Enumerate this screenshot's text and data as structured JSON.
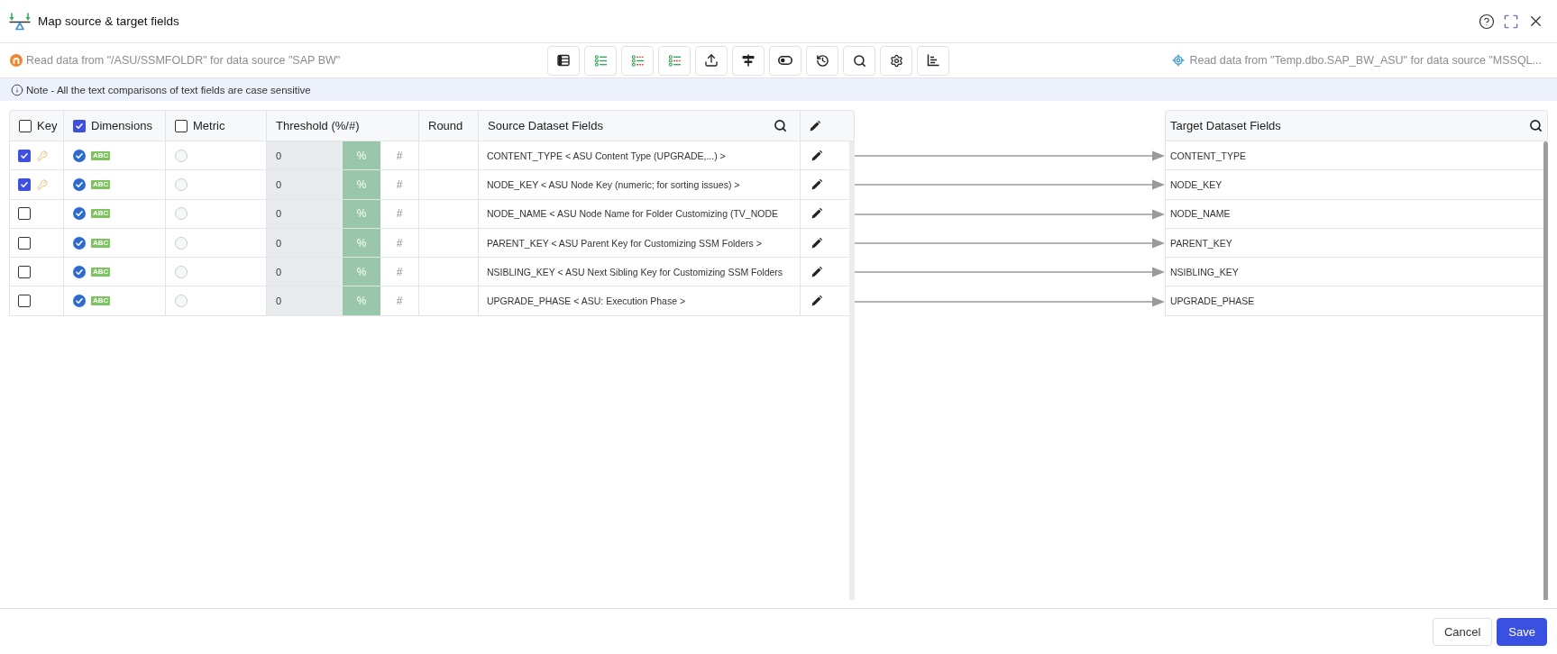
{
  "window": {
    "title": "Map source & target fields"
  },
  "source_info": {
    "text": "Read data from \"/ASU/SSMFOLDR\" for data source \"SAP BW\""
  },
  "toolbar": {
    "buttons": [
      {
        "kind": "table"
      },
      {
        "kind": "rows"
      },
      {
        "kind": "compare"
      },
      {
        "kind": "checklist"
      },
      {
        "kind": "upload"
      },
      {
        "kind": "split"
      },
      {
        "kind": "toggle"
      },
      {
        "kind": "history"
      },
      {
        "kind": "search"
      },
      {
        "kind": "settings"
      },
      {
        "kind": "chart"
      }
    ]
  },
  "target_info": {
    "text": "Read data from \"Temp.dbo.SAP_BW_ASU\" for data source \"MSSQL..."
  },
  "note": "Note - All the text comparisons of text fields are case sensitive",
  "source_table": {
    "header": {
      "key": {
        "label": "Key",
        "checked": false
      },
      "dimensions": {
        "label": "Dimensions",
        "checked": true
      },
      "metric": {
        "label": "Metric",
        "checked": false
      },
      "threshold": "Threshold (%/#)",
      "round": "Round",
      "field": "Source Dataset Fields"
    },
    "rows": [
      {
        "key": true,
        "dimension": true,
        "data_type": "ABC",
        "metric": false,
        "threshold": "0",
        "units": [
          {
            "label": "%",
            "selected": true
          },
          {
            "label": "#",
            "selected": false
          }
        ],
        "field": "CONTENT_TYPE < ASU Content Type (UPGRADE,...) >",
        "mapped": true
      },
      {
        "key": true,
        "dimension": true,
        "data_type": "ABC",
        "metric": false,
        "threshold": "0",
        "units": [
          {
            "label": "%",
            "selected": true
          },
          {
            "label": "#",
            "selected": false
          }
        ],
        "field": "NODE_KEY < ASU Node Key (numeric; for sorting issues) >",
        "mapped": true
      },
      {
        "key": false,
        "dimension": true,
        "data_type": "ABC",
        "metric": false,
        "threshold": "0",
        "units": [
          {
            "label": "%",
            "selected": true
          },
          {
            "label": "#",
            "selected": false
          }
        ],
        "field": "NODE_NAME < ASU Node Name for Folder Customizing (TV_NODE",
        "mapped": true
      },
      {
        "key": false,
        "dimension": true,
        "data_type": "ABC",
        "metric": false,
        "threshold": "0",
        "units": [
          {
            "label": "%",
            "selected": true
          },
          {
            "label": "#",
            "selected": false
          }
        ],
        "field": "PARENT_KEY < ASU Parent Key for Customizing SSM Folders >",
        "mapped": true
      },
      {
        "key": false,
        "dimension": true,
        "data_type": "ABC",
        "metric": false,
        "threshold": "0",
        "units": [
          {
            "label": "%",
            "selected": true
          },
          {
            "label": "#",
            "selected": false
          }
        ],
        "field": "NSIBLING_KEY < ASU Next Sibling Key for Customizing SSM Folders",
        "mapped": true
      },
      {
        "key": false,
        "dimension": true,
        "data_type": "ABC",
        "metric": false,
        "threshold": "0",
        "units": [
          {
            "label": "%",
            "selected": true
          },
          {
            "label": "#",
            "selected": false
          }
        ],
        "field": "UPGRADE_PHASE < ASU: Execution Phase >",
        "mapped": true
      }
    ]
  },
  "target_table": {
    "header": "Target Dataset Fields",
    "rows": [
      "CONTENT_TYPE",
      "NODE_KEY",
      "NODE_NAME",
      "PARENT_KEY",
      "NSIBLING_KEY",
      "UPGRADE_PHASE"
    ]
  },
  "footer": {
    "buttons": [
      {
        "label": "Cancel",
        "kind": "secondary"
      },
      {
        "label": "Save",
        "kind": "primary"
      }
    ]
  }
}
